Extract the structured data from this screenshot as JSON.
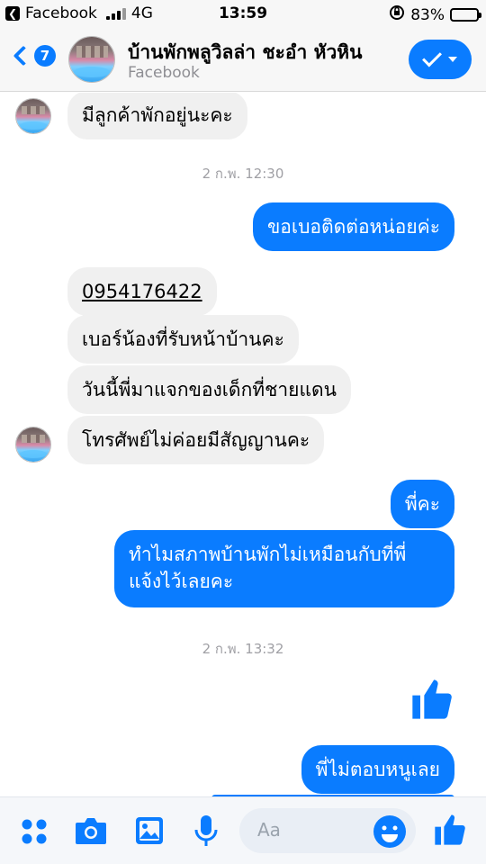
{
  "status_bar": {
    "back_app": "Facebook",
    "network": "4G",
    "time": "13:59",
    "battery": "83%",
    "battery_level": 0.83
  },
  "header": {
    "back_count": "7",
    "title": "บ้านพักพลูวิลล่า ชะอำ หัวหิน",
    "subtitle": "Facebook"
  },
  "messages": {
    "m1": "มีลูกค้าพักอยู่นะคะ",
    "ts1": "2 ก.พ. 12:30",
    "m2": "ขอเบอติดต่อหน่อยค่ะ",
    "m3": "0954176422",
    "m4": "เบอร์น้องที่รับหน้าบ้านคะ",
    "m5": "วันนี้พี่มาแจกของเด็กที่ชายแดน",
    "m6": "โทรศัพย์ไม่ค่อยมีสัญญานคะ",
    "m7": "พี่คะ",
    "m8_line1": "ทำไมสภาพบ้านพักไม่เหมือนกับที่พี่",
    "m8_line2": "แจ้งไว้เลยคะ",
    "ts2": "2 ก.พ. 13:32",
    "m9": "พี่ไม่ตอบหนูเลย"
  },
  "composer": {
    "placeholder": "Aa"
  },
  "colors": {
    "accent": "#0a7cff",
    "incoming": "#f0f0f0"
  },
  "icons": [
    "more-apps-icon",
    "camera-icon",
    "gallery-icon",
    "microphone-icon",
    "emoji-icon",
    "like-icon"
  ]
}
